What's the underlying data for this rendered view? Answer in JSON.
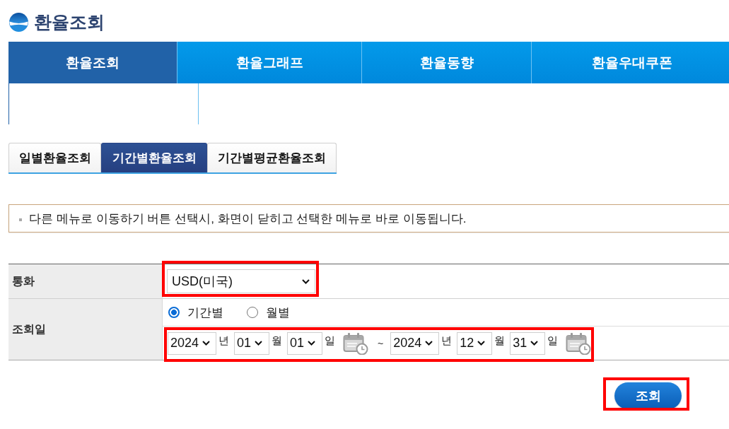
{
  "header": {
    "title": "환율조회"
  },
  "main_nav": [
    {
      "label": "환율조회",
      "selected": true
    },
    {
      "label": "환율그래프",
      "selected": false
    },
    {
      "label": "환율동향",
      "selected": false
    },
    {
      "label": "환율우대쿠폰",
      "selected": false
    }
  ],
  "sub_tabs": [
    {
      "label": "일별환율조회",
      "selected": false
    },
    {
      "label": "기간별환율조회",
      "selected": true
    },
    {
      "label": "기간별평균환율조회",
      "selected": false
    }
  ],
  "notice": {
    "text": "다른 메뉴로 이동하기 버튼 선택시, 화면이 닫히고 선택한 메뉴로 바로 이동됩니다."
  },
  "form": {
    "currency": {
      "label": "통화",
      "value": "USD(미국)",
      "highlighted": true
    },
    "query_date": {
      "label": "조회일",
      "modes": [
        {
          "label": "기간별",
          "selected": true
        },
        {
          "label": "월별",
          "selected": false
        }
      ],
      "range": {
        "highlighted": true,
        "start": {
          "year": "2024",
          "year_unit": "년",
          "month": "01",
          "month_unit": "월",
          "day": "01",
          "day_unit": "일"
        },
        "separator": "~",
        "end": {
          "year": "2024",
          "year_unit": "년",
          "month": "12",
          "month_unit": "월",
          "day": "31",
          "day_unit": "일"
        }
      }
    }
  },
  "search_button": {
    "label": "조회",
    "highlighted": true
  }
}
